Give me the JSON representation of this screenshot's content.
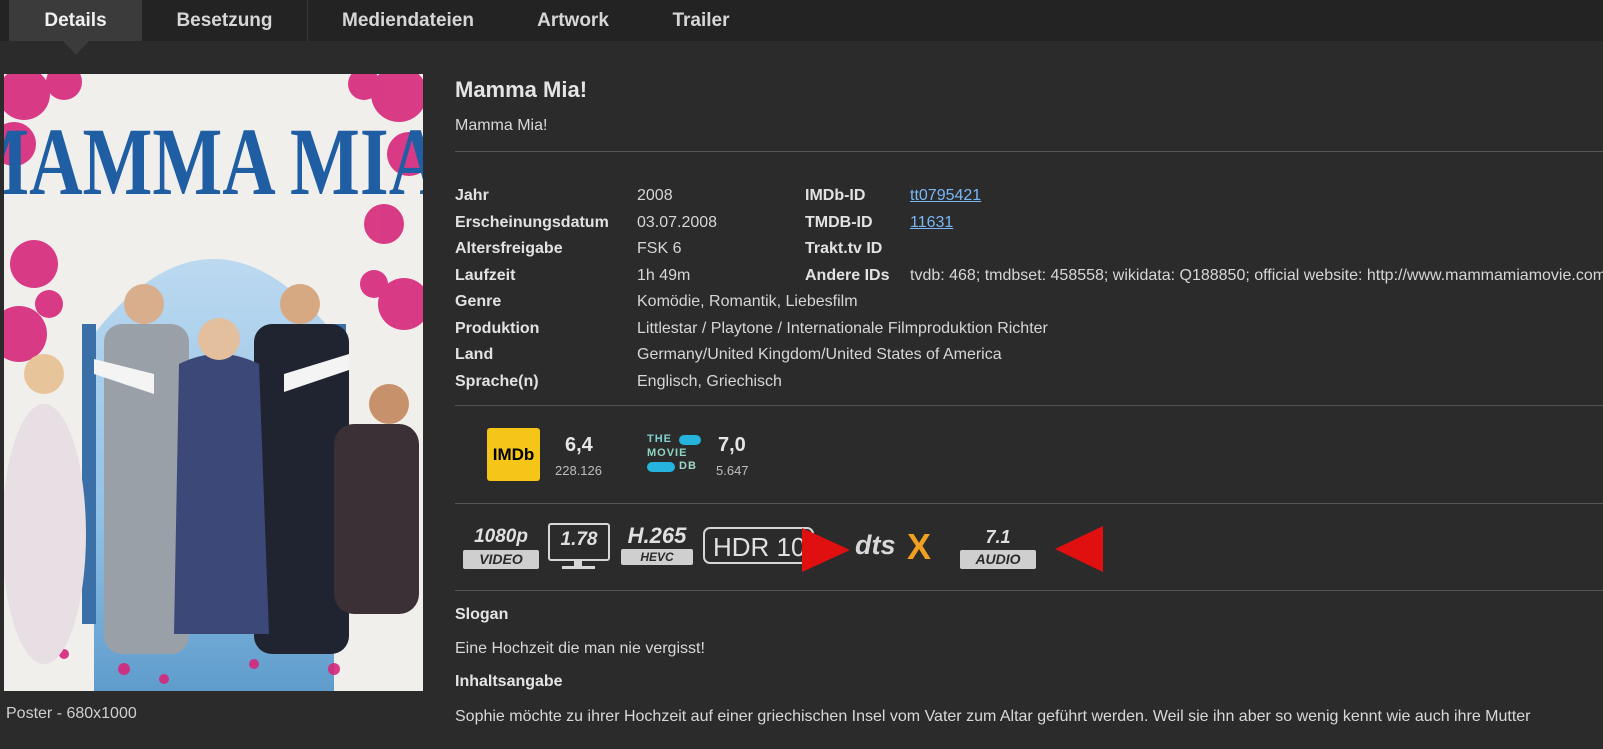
{
  "tabs": [
    "Details",
    "Besetzung",
    "Mediendateien",
    "Artwork",
    "Trailer"
  ],
  "poster": {
    "title_text": "MAMMA MIA!",
    "caption": "Poster - 680x1000"
  },
  "movie": {
    "title": "Mamma Mia!",
    "original_title": "Mamma Mia!"
  },
  "details": [
    {
      "label": "Jahr",
      "value": "2008"
    },
    {
      "label": "Erscheinungsdatum",
      "value": "03.07.2008"
    },
    {
      "label": "Altersfreigabe",
      "value": "FSK 6"
    },
    {
      "label": "Laufzeit",
      "value": "1h 49m"
    },
    {
      "label": "Genre",
      "value": "Komödie, Romantik, Liebesfilm"
    },
    {
      "label": "Produktion",
      "value": "Littlestar / Playtone / Internationale Filmproduktion Richter"
    },
    {
      "label": "Land",
      "value": "Germany/United Kingdom/United States of America"
    },
    {
      "label": "Sprache(n)",
      "value": "Englisch, Griechisch"
    }
  ],
  "ids": [
    {
      "label": "IMDb-ID",
      "value": "tt0795421"
    },
    {
      "label": "TMDB-ID",
      "value": "11631"
    },
    {
      "label": "Trakt.tv ID",
      "value": ""
    },
    {
      "label": "Andere IDs",
      "value": "tvdb: 468; tmdbset: 458558; wikidata: Q188850; official website: http://www.mammamiamovie.com"
    }
  ],
  "ratings": {
    "imdb": {
      "logo": "IMDb",
      "rating": "6,4",
      "votes": "228.126"
    },
    "tmdb": {
      "logo_lines": [
        "THE",
        "MOVIE",
        "DB"
      ],
      "rating": "7,0",
      "votes": "5.647"
    }
  },
  "media_flags": {
    "resolution": "1080p",
    "resolution_sub": "VIDEO",
    "aspect": "1.78",
    "codec": "H.265",
    "codec_sub": "HEVC",
    "hdr": "HDR 10",
    "audio_codec_logo": "dts",
    "audio_codec_logo_x": "X",
    "channels": "7.1",
    "channels_sub": "AUDIO"
  },
  "arrow_color": "#e01010",
  "slogan": {
    "heading": "Slogan",
    "text": "Eine Hochzeit die man nie vergisst!"
  },
  "plot": {
    "heading": "Inhaltsangabe",
    "text": "Sophie möchte zu ihrer Hochzeit auf einer griechischen Insel vom Vater zum Altar geführt werden. Weil sie ihn aber so wenig kennt wie auch ihre Mutter"
  }
}
